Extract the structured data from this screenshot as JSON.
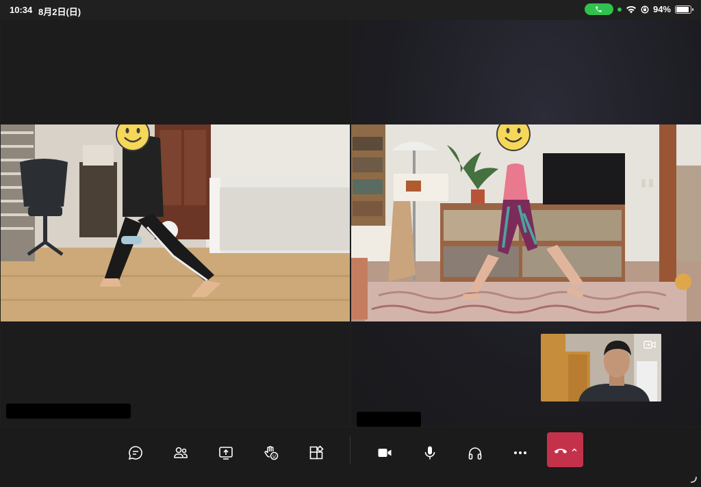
{
  "status_bar": {
    "time": "10:34",
    "date": "8月2日(日)",
    "battery_percent": "94%",
    "battery_level": 0.94,
    "call_pill_color": "#2fc24e"
  },
  "toolbar": {
    "buttons": [
      {
        "name": "chat-button",
        "icon": "chat-bubble-icon"
      },
      {
        "name": "people-button",
        "icon": "people-icon"
      },
      {
        "name": "share-screen-button",
        "icon": "share-screen-icon"
      },
      {
        "name": "raise-hand-button",
        "icon": "raise-hand-reaction-icon"
      },
      {
        "name": "apps-button",
        "icon": "apps-icon"
      },
      {
        "name": "camera-button",
        "icon": "video-camera-icon"
      },
      {
        "name": "microphone-button",
        "icon": "microphone-icon"
      },
      {
        "name": "audio-device-button",
        "icon": "headphones-icon"
      },
      {
        "name": "more-options-button",
        "icon": "more-horizontal-icon"
      }
    ],
    "leave": {
      "icon": "hang-up-phone-icon",
      "color": "#c4314b"
    }
  },
  "participants": [
    {
      "tile": "left",
      "face_cover": "smiley-face-icon"
    },
    {
      "tile": "right",
      "face_cover": "smiley-face-icon"
    }
  ],
  "self_view": {
    "toggle_icon": "switch-camera-icon"
  },
  "colors": {
    "background": "#1f1f1f",
    "hangup": "#c4314b",
    "accent_green": "#2fc24e"
  }
}
